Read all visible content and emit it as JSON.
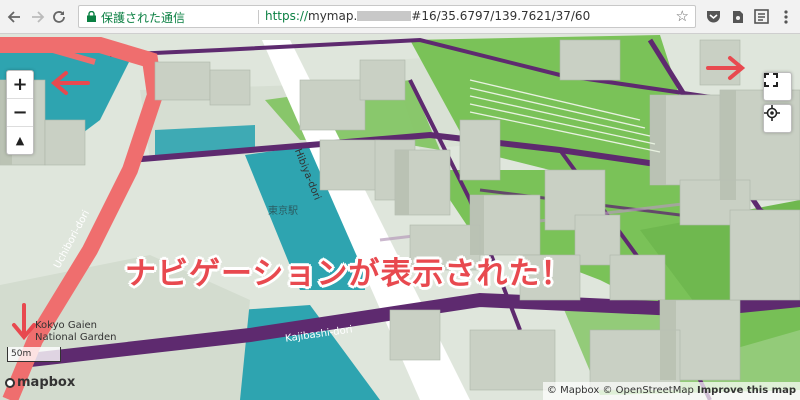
{
  "browser": {
    "back_icon": "arrow-left-icon",
    "forward_icon": "arrow-right-icon",
    "reload_icon": "reload-icon",
    "secure_label": "保護された通信",
    "url_scheme": "https://",
    "url_host": "mymap.",
    "url_rest": "#16/35.6797/139.7621/37/60",
    "star_icon": "star-icon",
    "extensions": [
      "pocket-icon",
      "evernote-icon",
      "reader-icon",
      "menu-icon"
    ]
  },
  "map": {
    "zoom_in_label": "+",
    "zoom_out_label": "−",
    "compass_label": "▲",
    "fullscreen_icon": "fullscreen-icon",
    "locate_icon": "geolocate-icon",
    "scale_label": "50m",
    "logo_label": "mapbox",
    "attribution": {
      "mapbox": "© Mapbox",
      "osm": "© OpenStreetMap",
      "improve": "Improve this map"
    },
    "roads": {
      "uchibori": "Uchibori-dori",
      "hibiya": "Hibiya-dori",
      "kajibashi": "Kajibashi-dori"
    },
    "places": {
      "garden_line1": "Kokyo Gaien",
      "garden_line2": "National Garden",
      "station_jp": "東京駅"
    },
    "colors": {
      "park": "#7ac258",
      "water": "#2ea4b0",
      "highway": "#ef6e6e",
      "major_road": "#5e2a6f",
      "building": "#c9d0c4",
      "annotation": "#e8494f"
    }
  },
  "annotation": {
    "banner_text": "ナビゲーションが表示された！",
    "arrow_left": "←",
    "arrow_right": "→",
    "arrow_down": "↓"
  }
}
